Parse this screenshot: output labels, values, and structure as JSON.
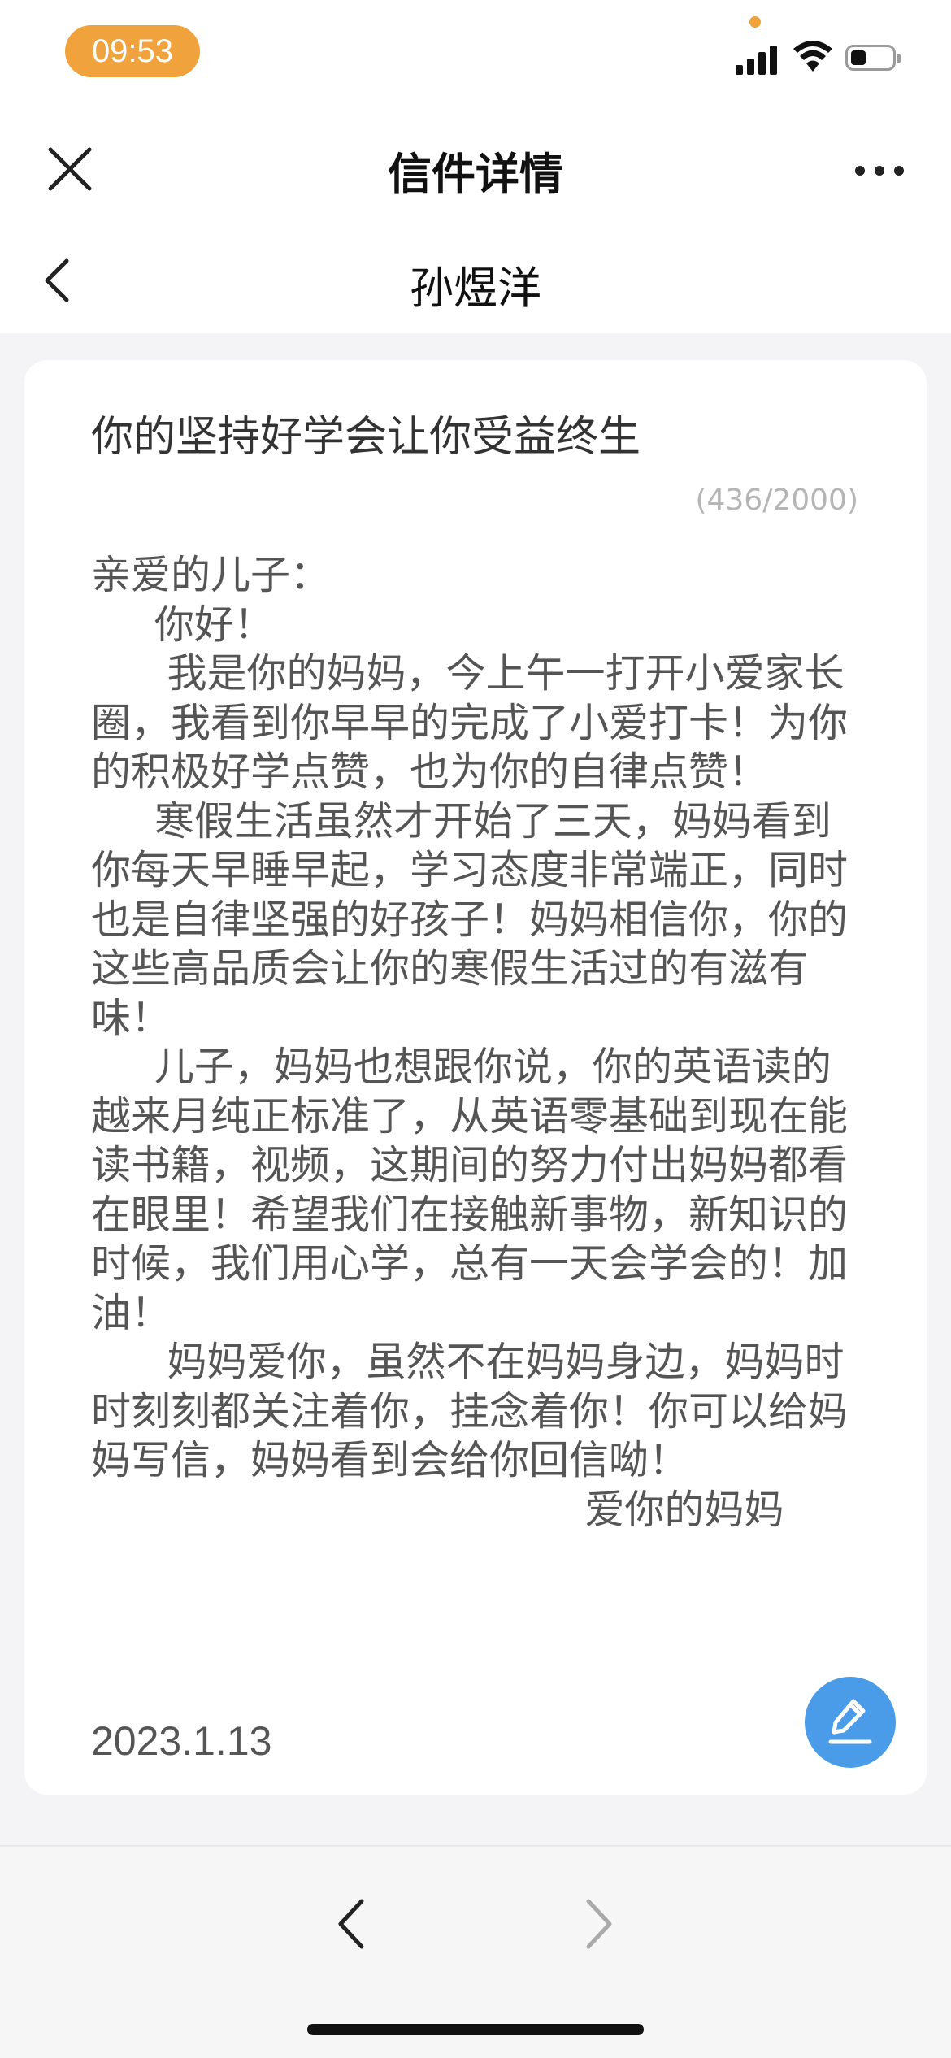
{
  "status_bar": {
    "time": "09:53"
  },
  "nav": {
    "title": "信件详情"
  },
  "recipient": {
    "name": "孙煜洋"
  },
  "letter": {
    "title": "你的坚持好学会让你受益终生",
    "char_count": "(436/2000)",
    "body": "亲爱的儿子：\n     你好！\n      我是你的妈妈，今上午一打开小爱家长圈，我看到你早早的完成了小爱打卡！为你的积极好学点赞，也为你的自律点赞！\n     寒假生活虽然才开始了三天，妈妈看到你每天早睡早起，学习态度非常端正，同时也是自律坚强的好孩子！妈妈相信你，你的这些高品质会让你的寒假生活过的有滋有味！\n     儿子，妈妈也想跟你说，你的英语读的越来月纯正标准了，从英语零基础到现在能读书籍，视频，这期间的努力付出妈妈都看在眼里！希望我们在接触新事物，新知识的时候，我们用心学，总有一天会学会的！加油！\n      妈妈爱你，虽然不在妈妈身边，妈妈时时刻刻都关注着你，挂念着你！你可以给妈妈写信，妈妈看到会给你回信呦！\n                                       爱你的妈妈",
    "date": "2023.1.13"
  },
  "icons": {
    "close": "close-icon",
    "more": "more-icon",
    "back": "chevron-left-icon",
    "edit": "pencil-edit-icon",
    "prev": "chevron-left-icon",
    "next": "chevron-right-icon"
  },
  "colors": {
    "time_pill": "#f0a23c",
    "edit_button": "#4a9be8",
    "background": "#f4f4f6"
  }
}
